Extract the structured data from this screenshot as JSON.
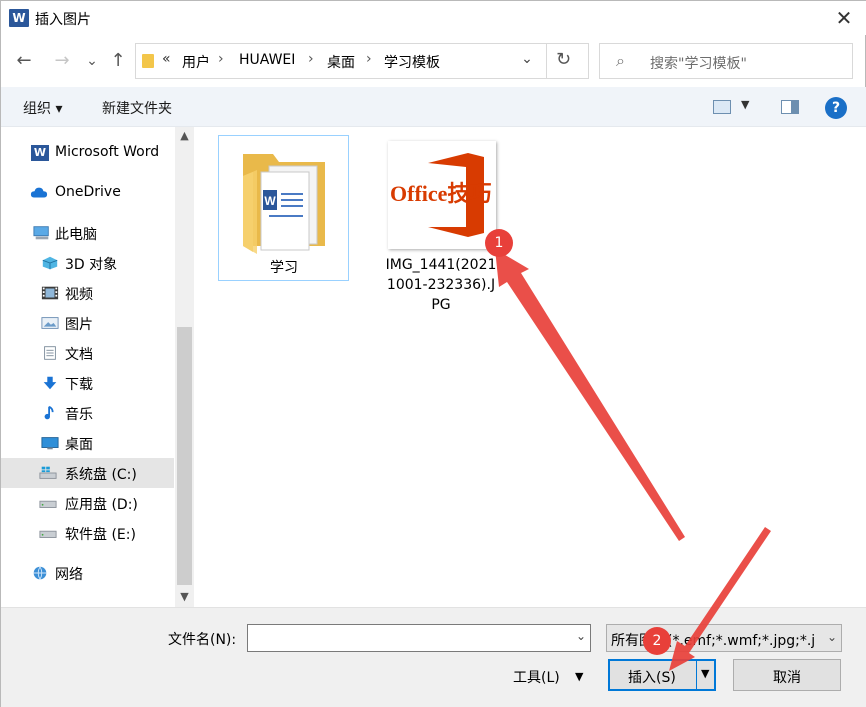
{
  "titlebar": {
    "app_icon_letter": "W",
    "title": "插入图片",
    "close": "✕"
  },
  "nav": {
    "back": "←",
    "forward": "→",
    "recent": "⌄",
    "up": "↑",
    "overflow": "«",
    "breadcrumbs": [
      "用户",
      "HUAWEI",
      "桌面",
      "学习模板"
    ],
    "separator": "›",
    "dropdown": "⌄",
    "refresh": "↻",
    "search_icon": "⌕",
    "search_placeholder": "搜索\"学习模板\""
  },
  "commands": {
    "organize": "组织 ▾",
    "new_folder": "新建文件夹",
    "view_dropdown": "▼",
    "help": "?"
  },
  "sidebar": {
    "items": [
      {
        "label": "Microsoft Word",
        "icon": "word-icon"
      },
      {
        "label": "OneDrive",
        "icon": "cloud-icon"
      },
      {
        "label": "此电脑",
        "icon": "computer-icon"
      },
      {
        "label": "3D 对象",
        "icon": "cube-icon"
      },
      {
        "label": "视频",
        "icon": "film-icon"
      },
      {
        "label": "图片",
        "icon": "picture-icon"
      },
      {
        "label": "文档",
        "icon": "document-icon"
      },
      {
        "label": "下载",
        "icon": "download-icon"
      },
      {
        "label": "音乐",
        "icon": "music-icon"
      },
      {
        "label": "桌面",
        "icon": "desktop-icon"
      },
      {
        "label": "系统盘 (C:)",
        "icon": "drive-c-icon"
      },
      {
        "label": "应用盘 (D:)",
        "icon": "drive-icon"
      },
      {
        "label": "软件盘 (E:)",
        "icon": "drive-icon"
      },
      {
        "label": "网络",
        "icon": "network-icon"
      }
    ],
    "selected_index": 10,
    "scroll_up": "▲",
    "scroll_down": "▼"
  },
  "files": [
    {
      "label": "学习",
      "type": "folder"
    },
    {
      "label": "IMG_1441(20211001-232336).JPG",
      "label_lines": [
        "IMG_1441(2021",
        "1001-232336).J",
        "PG"
      ],
      "type": "image",
      "thumb_text": "Office技巧"
    }
  ],
  "bottom": {
    "filename_label": "文件名(N):",
    "filename_value": "",
    "dropdown": "⌄",
    "filter": "所有图片(*.emf;*.wmf;*.jpg;*.j",
    "tools": "工具(L)",
    "tools_dd": "▼",
    "insert": "插入(S)",
    "insert_dd": "▼",
    "cancel": "取消"
  },
  "annotations": {
    "step1": "1",
    "step2": "2"
  },
  "colors": {
    "accent": "#0078d7",
    "annotation": "#e8403a",
    "office_red": "#d83b01"
  }
}
